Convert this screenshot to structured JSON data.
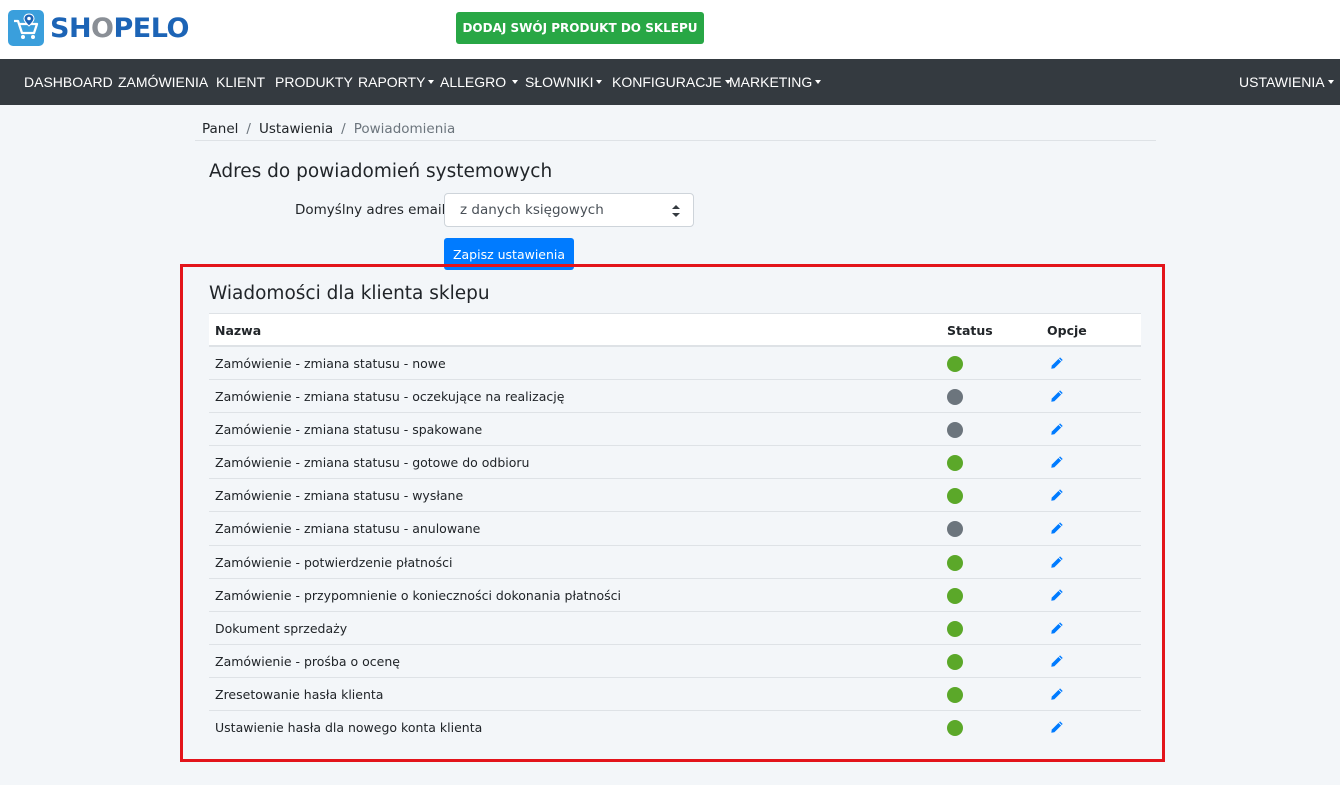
{
  "header": {
    "logo_prefix": "SH",
    "logo_o": "O",
    "logo_suffix": "PELO",
    "cta_label": "DODAJ SWÓJ PRODUKT DO SKLEPU"
  },
  "nav": {
    "items": [
      {
        "label": "DASHBOARD"
      },
      {
        "label": "ZAMÓWIENIA"
      },
      {
        "label": "KLIENT"
      },
      {
        "label": "PRODUKTY"
      },
      {
        "label": "RAPORTY"
      },
      {
        "label": "ALLEGRO"
      },
      {
        "label": "SŁOWNIKI"
      },
      {
        "label": "KONFIGURACJE"
      },
      {
        "label": "MARKETING"
      }
    ],
    "settings_label": "USTAWIENIA"
  },
  "breadcrumb": {
    "items": [
      "Panel",
      "Ustawienia",
      "Powiadomienia"
    ],
    "separator": "/"
  },
  "system_section": {
    "title": "Adres do powiadomień systemowych",
    "email_label": "Domyślny adres email",
    "email_value": "z danych księgowych",
    "save_label": "Zapisz ustawienia"
  },
  "messages_section": {
    "title": "Wiadomości dla klienta sklepu",
    "columns": {
      "name": "Nazwa",
      "status": "Status",
      "options": "Opcje"
    },
    "rows": [
      {
        "name": "Zamówienie - zmiana statusu - nowe",
        "active": true
      },
      {
        "name": "Zamówienie - zmiana statusu - oczekujące na realizację",
        "active": false
      },
      {
        "name": "Zamówienie - zmiana statusu - spakowane",
        "active": false
      },
      {
        "name": "Zamówienie - zmiana statusu - gotowe do odbioru",
        "active": true
      },
      {
        "name": "Zamówienie - zmiana statusu - wysłane",
        "active": true
      },
      {
        "name": "Zamówienie - zmiana statusu - anulowane",
        "active": false
      },
      {
        "name": "Zamówienie - potwierdzenie płatności",
        "active": true
      },
      {
        "name": "Zamówienie - przypomnienie o konieczności dokonania płatności",
        "active": true
      },
      {
        "name": "Dokument sprzedaży",
        "active": true
      },
      {
        "name": "Zamówienie - prośba o ocenę",
        "active": true
      },
      {
        "name": "Zresetowanie hasła klienta",
        "active": true
      },
      {
        "name": "Ustawienie hasła dla nowego konta klienta",
        "active": true
      }
    ]
  },
  "colors": {
    "active": "#5ba829",
    "inactive": "#6c757d",
    "accent": "#007bff",
    "cta": "#28a745",
    "nav_bg": "#343a40",
    "highlight": "#e3141b"
  },
  "icons": {
    "edit": "pencil-icon",
    "logo": "cart-location-icon",
    "select": "sort-arrows-icon"
  }
}
